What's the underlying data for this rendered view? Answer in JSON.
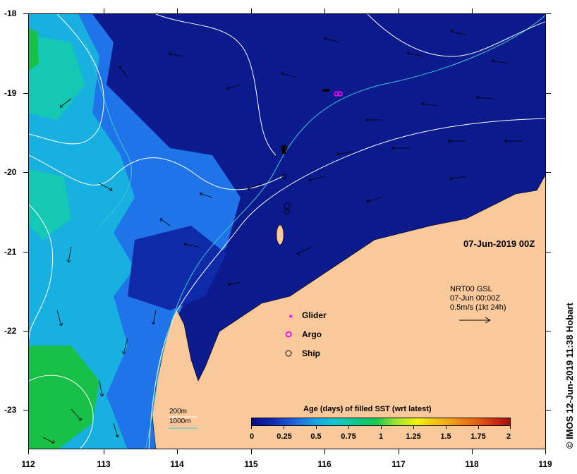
{
  "axes": {
    "y_ticks": [
      "-18",
      "-19",
      "-20",
      "-21",
      "-22",
      "-23"
    ],
    "x_ticks": [
      "112",
      "113",
      "114",
      "115",
      "116",
      "117",
      "118",
      "119"
    ]
  },
  "date_label": "07-Jun-2019 00Z",
  "gsl": {
    "line1": "NRT00 GSL",
    "line2": "07-Jun 00:00Z",
    "line3": "0.5m/s (1kt 24h)"
  },
  "legend": {
    "glider": "Glider",
    "argo": "Argo",
    "ship": "Ship"
  },
  "isobaths": {
    "label_200": "200m",
    "label_1000": "1000m",
    "color_200": "#ffffff",
    "color_1000": "#3cc8d8"
  },
  "colorbar": {
    "title": "Age (days) of filled SST (wrt latest)",
    "ticks": [
      "0",
      "0.25",
      "0.5",
      "0.75",
      "1",
      "1.25",
      "1.5",
      "1.75",
      "2"
    ]
  },
  "copyright": "© IMOS 12-Jun-2019 11:38 Hobart",
  "colors": {
    "land": "#f9c89b",
    "ocean_latest": "#0b1a8c",
    "age_mid": "#1e74e8",
    "age_cyan": "#18b0e0",
    "age_green": "#18c048",
    "glider": "#ff00ff",
    "argo": "#ff00ff"
  },
  "platforms": {
    "glider_lon": 116.2,
    "glider_lat": -19.0,
    "ship_lon": 115.5,
    "ship_lat": -20.4
  }
}
